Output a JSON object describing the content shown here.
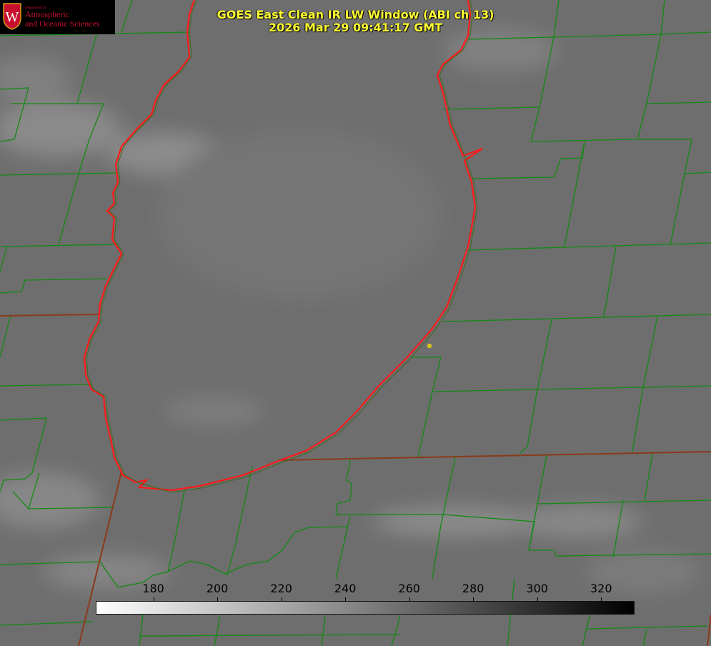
{
  "title": {
    "line1": "GOES East Clean IR LW Window (ABI ch 13)",
    "line2": "2026 Mar 29 09:41:17 GMT"
  },
  "logo": {
    "dept": "Department of",
    "line1": "Atmospheric",
    "line2": "and Oceanic Sciences",
    "seal_letter": "W"
  },
  "colorbar": {
    "ticks": [
      "180",
      "200",
      "220",
      "240",
      "260",
      "280",
      "300",
      "320"
    ],
    "range": [
      162,
      330
    ]
  },
  "colors": {
    "background": "#6f6f6f",
    "county_lines": "#138a13",
    "state_lines": "#8b3a1a",
    "shoreline": "#ff1a1a",
    "title": "#ffff33",
    "marker": "#d6c21a"
  }
}
